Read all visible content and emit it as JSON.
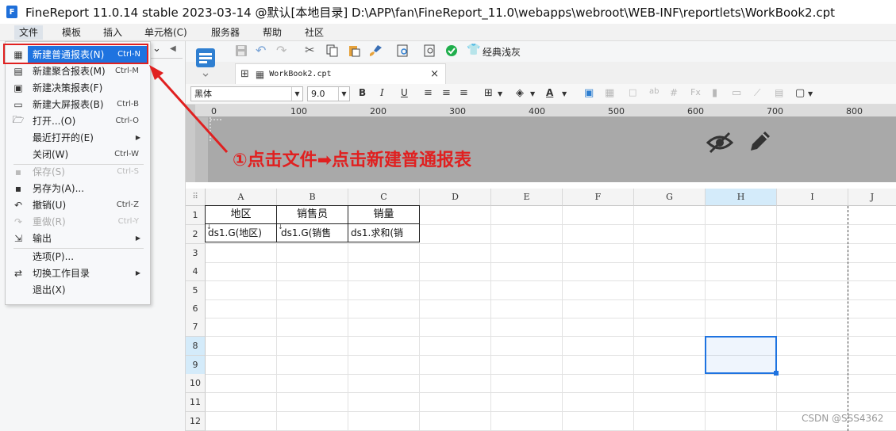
{
  "window": {
    "title": "FineReport 11.0.14 stable 2023-03-14 @默认[本地目录]    D:\\APP\\fan\\FineReport_11.0\\webapps\\webroot\\WEB-INF\\reportlets\\WorkBook2.cpt",
    "logo_icon": "finereport-logo-icon",
    "logo_letter": "F"
  },
  "menubar": {
    "items": [
      "文件",
      "模板",
      "插入",
      "单元格(C)",
      "服务器",
      "帮助",
      "社区"
    ]
  },
  "file_menu": {
    "items": [
      {
        "icon": "new-report-icon",
        "label": "新建普通报表(N)",
        "shortcut": "Ctrl-N",
        "highlighted": true
      },
      {
        "icon": "new-aggregate-report-icon",
        "label": "新建聚合报表(M)",
        "shortcut": "Ctrl-M"
      },
      {
        "icon": "new-decision-report-icon",
        "label": "新建决策报表(F)",
        "shortcut": ""
      },
      {
        "icon": "new-large-screen-icon",
        "label": "新建大屏报表(B)",
        "shortcut": "Ctrl-B"
      },
      {
        "icon": "open-folder-icon",
        "label": "打开...(O)",
        "shortcut": "Ctrl-O"
      },
      {
        "icon": "",
        "label": "最近打开的(E)",
        "shortcut": "",
        "submenu": true
      },
      {
        "icon": "",
        "label": "关闭(W)",
        "shortcut": "Ctrl-W"
      },
      {
        "icon": "save-icon",
        "label": "保存(S)",
        "shortcut": "Ctrl-S",
        "disabled": true
      },
      {
        "icon": "save-as-icon",
        "label": "另存为(A)...",
        "shortcut": ""
      },
      {
        "icon": "undo-icon",
        "label": "撤销(U)",
        "shortcut": "Ctrl-Z"
      },
      {
        "icon": "redo-icon",
        "label": "重做(R)",
        "shortcut": "Ctrl-Y",
        "disabled": true
      },
      {
        "icon": "export-icon",
        "label": "输出",
        "shortcut": "",
        "submenu": true
      },
      {
        "icon": "",
        "label": "选项(P)...",
        "shortcut": ""
      },
      {
        "icon": "switch-icon",
        "label": "切换工作目录",
        "shortcut": "",
        "submenu": true
      },
      {
        "icon": "",
        "label": "退出(X)",
        "shortcut": ""
      }
    ]
  },
  "toolbar": {
    "theme_label": "经典浅灰"
  },
  "tab": {
    "filename": "WorkBook2.cpt"
  },
  "format_bar": {
    "font": "黑体",
    "size": "9.0",
    "bold": "B",
    "italic": "I",
    "underline": "U",
    "font_color_glyph": "A"
  },
  "ruler": {
    "labels": [
      "0",
      "100",
      "200",
      "300",
      "400",
      "500",
      "600",
      "700",
      "800"
    ]
  },
  "annotation": {
    "text": "①点击文件➡点击新建普通报表"
  },
  "sheet": {
    "columns": [
      "A",
      "B",
      "C",
      "D",
      "E",
      "F",
      "G",
      "H",
      "I",
      "J"
    ],
    "rows": [
      "1",
      "2",
      "3",
      "4",
      "5",
      "6",
      "7",
      "8",
      "9",
      "10",
      "11",
      "12"
    ],
    "cells": {
      "A1": "地区",
      "B1": "销售员",
      "C1": "销量",
      "A2": "ds1.G(地区)",
      "B2": "ds1.G(销售",
      "C2": "ds1.求和(销"
    },
    "selected_column": "H",
    "selected_rows": [
      "8",
      "9"
    ]
  },
  "colors": {
    "accent": "#1e73e0",
    "annotation_red": "#e02020"
  },
  "watermark": "CSDN @SSS4362"
}
